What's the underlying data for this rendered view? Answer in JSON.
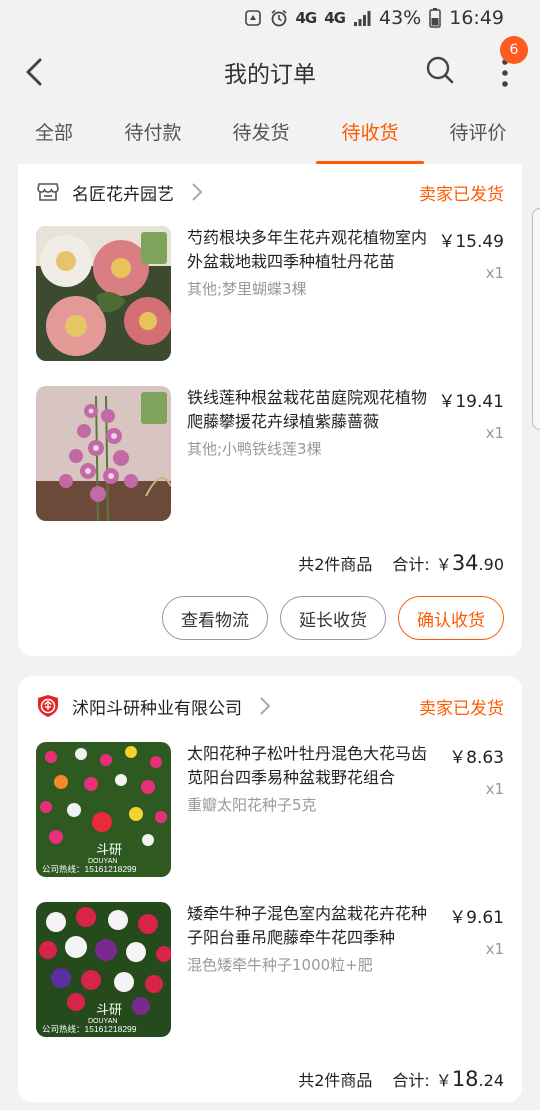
{
  "statusbar": {
    "network_4g_a": "4G",
    "network_4g_b": "4G",
    "battery_pct": "43%",
    "time": "16:49"
  },
  "header": {
    "title": "我的订单",
    "badge": "6",
    "icons": {
      "back": "back-arrow-icon",
      "search": "search-icon",
      "more": "more-vertical-icon"
    }
  },
  "tabs": [
    {
      "label": "全部"
    },
    {
      "label": "待付款"
    },
    {
      "label": "待发货"
    },
    {
      "label": "待收货",
      "active": true
    },
    {
      "label": "待评价"
    }
  ],
  "orders": [
    {
      "shop": "名匠花卉园艺",
      "status": "卖家已发货",
      "items": [
        {
          "title": "芍药根块多年生花卉观花植物室内外盆栽地栽四季种植牡丹花苗",
          "spec": "其他;梦里蝴蝶3棵",
          "price": "￥15.49",
          "qty": "x1",
          "thumb_colors": {
            "bg": "#3c4a2f",
            "flower": "#e8a0a0",
            "label": "#7fa35a"
          }
        },
        {
          "title": "铁线莲种根盆栽花苗庭院观花植物爬藤攀援花卉绿植紫藤蔷薇",
          "spec": "其他;小鸭铁线莲3棵",
          "price": "￥19.41",
          "qty": "x1",
          "thumb_colors": {
            "bg": "#d8c5c2",
            "flower": "#c26aa5",
            "label": "#7fa35a"
          }
        }
      ],
      "summary_count": "共2件商品",
      "summary_label": "合计:",
      "total_symbol": "￥",
      "total_int": "34",
      "total_dec": ".90",
      "buttons": [
        "查看物流",
        "延长收货",
        "确认收货"
      ]
    },
    {
      "shop": "沭阳斗研种业有限公司",
      "status": "卖家已发货",
      "items": [
        {
          "title": "太阳花种子松叶牡丹混色大花马齿苋阳台四季易种盆栽野花组合",
          "spec": "重瓣太阳花种子5克",
          "price": "￥8.63",
          "qty": "x1",
          "watermark": "斗研",
          "watermark_sub": "DOUYAN",
          "hotline": "公司热线：15161218299",
          "thumb_colors": {
            "bg": "#2e5a22",
            "flower": "#e8307a"
          }
        },
        {
          "title": "矮牵牛种子混色室内盆栽花卉花种子阳台垂吊爬藤牵牛花四季种",
          "spec": "混色矮牵牛种子1000粒+肥",
          "price": "￥9.61",
          "qty": "x1",
          "watermark": "斗研",
          "watermark_sub": "DOUYAN",
          "hotline": "公司热线：15161218299",
          "thumb_colors": {
            "bg": "#254a1c",
            "flower": "#d8234a"
          }
        }
      ],
      "summary_count": "共2件商品",
      "summary_label": "合计:",
      "total_symbol": "￥",
      "total_int": "18",
      "total_dec": ".24"
    }
  ],
  "colors": {
    "accent": "#ff5a00",
    "badge": "#ff5a1f",
    "background": "#f2f2f2"
  }
}
